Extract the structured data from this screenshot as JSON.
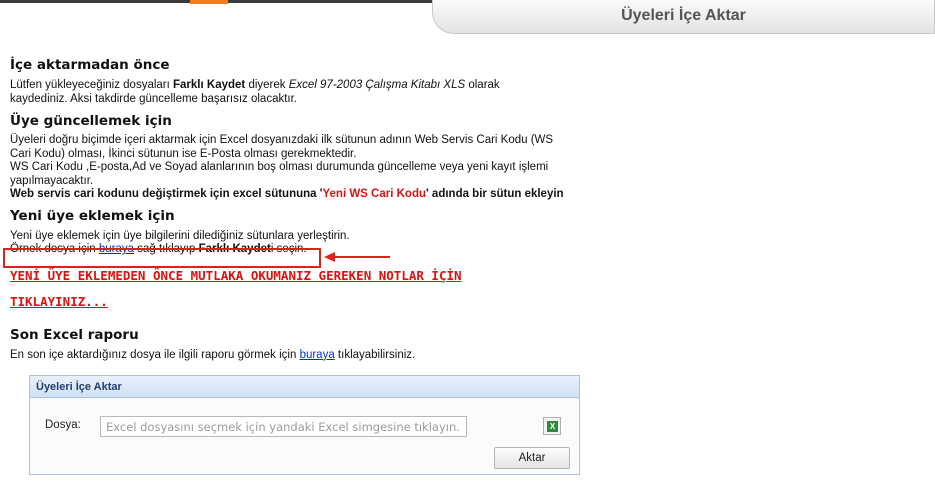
{
  "header": {
    "title": "Üyeleri İçe Aktar"
  },
  "before": {
    "heading": "İçe aktarmadan önce",
    "t1": "Lütfen yükleyeceğiniz dosyaları ",
    "b1": "Farklı Kaydet",
    "t2": " diyerek ",
    "i1": "Excel 97-2003 Çalışma Kitabı XLS",
    "t3": " olarak",
    "line2": "kaydediniz. Aksi takdirde güncelleme başarısız olacaktır."
  },
  "update": {
    "heading": "Üye güncellemek için",
    "line1": "Üyeleri doğru biçimde içeri aktarmak için Excel dosyanızdaki ilk sütunun adının Web Servis Cari Kodu (WS",
    "line2": "Cari Kodu) olması, İkinci sütunun ise E-Posta olması gerekmektedir.",
    "line3": "WS Cari Kodu ,E-posta,Ad ve Soyad alanlarının boş olması durumunda güncelleme veya yeni kayıt işlemi",
    "line4": "yapılmayacaktır.",
    "bold_a": "Web servis cari kodunu değiştirmek için excel sütununa '",
    "bold_red": "Yeni WS Cari Kodu",
    "bold_b": "' adında bir sütun ekleyin"
  },
  "new_member": {
    "heading": "Yeni üye eklemek için",
    "line1": "Yeni üye eklemek için üye bilgilerini dilediğiniz sütunlara yerleştirin.",
    "s1": "Örnek dosya için ",
    "link": "buraya",
    "s2": " sağ tıklayıp ",
    "b": "Farklı Kaydet",
    "s3": "i seçin.",
    "warning_line1": "YENİ ÜYE EKLEMEDEN ÖNCE MUTLAKA OKUMANIZ GEREKEN NOTLAR İÇİN",
    "warning_line2": "TIKLAYINIZ..."
  },
  "report": {
    "heading": "Son Excel raporu",
    "s1": "En son içe aktardığınız dosya ile ilgili raporu görmek için ",
    "link": "buraya",
    "s2": " tıklayabilirsiniz."
  },
  "form": {
    "title": "Üyeleri İçe Aktar",
    "file_label": "Dosya:",
    "file_placeholder": "Excel dosyasını seçmek için yandaki Excel simgesine tıklayın.",
    "xls_icon": "excel-icon",
    "submit": "Aktar"
  },
  "colors": {
    "highlight_box": "#d9241b",
    "warning_red": "#e01010",
    "link_blue": "#0033cc"
  }
}
